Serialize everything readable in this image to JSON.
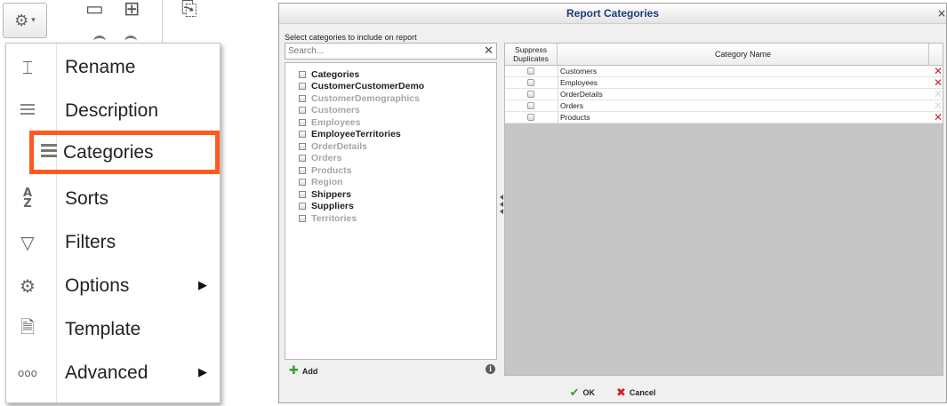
{
  "toolbar": {
    "gear_icon": "⚙",
    "caret_icon": "▾"
  },
  "menu": {
    "items": [
      {
        "label": "Rename",
        "icon": "rename-icon"
      },
      {
        "label": "Description",
        "icon": "lines-icon"
      },
      {
        "label": "Categories",
        "icon": "bars-icon"
      },
      {
        "label": "Sorts",
        "icon": "sort-az-icon"
      },
      {
        "label": "Filters",
        "icon": "funnel-icon"
      },
      {
        "label": "Options",
        "icon": "gear-icon"
      },
      {
        "label": "Template",
        "icon": "document-icon"
      },
      {
        "label": "Advanced",
        "icon": "ellipsis-icon"
      }
    ],
    "highlighted": "Categories",
    "accent_color": "#ff5a1f"
  },
  "dialog": {
    "title": "Report Categories",
    "instruction": "Select categories to include on report",
    "search": {
      "placeholder": "Search...",
      "value": ""
    },
    "categories": [
      {
        "label": "Categories",
        "enabled": true
      },
      {
        "label": "CustomerCustomerDemo",
        "enabled": true
      },
      {
        "label": "CustomerDemographics",
        "enabled": false
      },
      {
        "label": "Customers",
        "enabled": false
      },
      {
        "label": "Employees",
        "enabled": false
      },
      {
        "label": "EmployeeTerritories",
        "enabled": true
      },
      {
        "label": "OrderDetails",
        "enabled": false
      },
      {
        "label": "Orders",
        "enabled": false
      },
      {
        "label": "Products",
        "enabled": false
      },
      {
        "label": "Region",
        "enabled": false
      },
      {
        "label": "Shippers",
        "enabled": true
      },
      {
        "label": "Suppliers",
        "enabled": true
      },
      {
        "label": "Territories",
        "enabled": false
      }
    ],
    "add_label": "Add",
    "grid": {
      "col_suppress_line1": "Suppress",
      "col_suppress_line2": "Duplicates",
      "col_name": "Category Name",
      "rows": [
        {
          "name": "Customers",
          "delete_active": true
        },
        {
          "name": "Employees",
          "delete_active": true
        },
        {
          "name": "OrderDetails",
          "delete_active": false
        },
        {
          "name": "Orders",
          "delete_active": false
        },
        {
          "name": "Products",
          "delete_active": true
        }
      ]
    },
    "ok_label": "OK",
    "cancel_label": "Cancel"
  }
}
